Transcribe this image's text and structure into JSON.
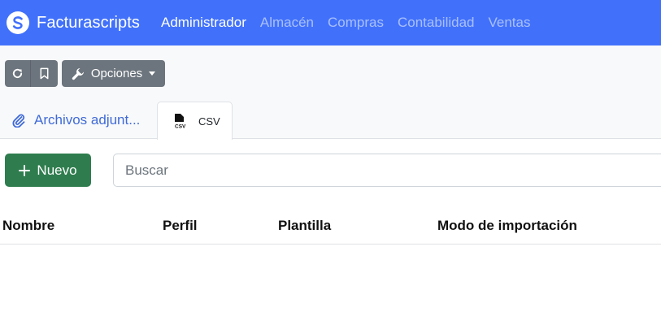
{
  "navbar": {
    "brand": "Facturascripts",
    "items": [
      {
        "label": "Administrador",
        "active": true
      },
      {
        "label": "Almacén",
        "active": false
      },
      {
        "label": "Compras",
        "active": false
      },
      {
        "label": "Contabilidad",
        "active": false
      },
      {
        "label": "Ventas",
        "active": false
      }
    ]
  },
  "toolbar": {
    "refresh_icon": "refresh-icon",
    "bookmark_icon": "bookmark-icon",
    "options_label": "Opciones",
    "options_icon": "wrench-icon"
  },
  "tabs": [
    {
      "label": "Archivos adjunt...",
      "icon": "paperclip-icon",
      "active": false
    },
    {
      "label": "CSV",
      "icon": "csv-file-icon",
      "active": true
    }
  ],
  "actions": {
    "new_label": "Nuevo",
    "search_placeholder": "Buscar"
  },
  "table": {
    "columns": [
      "Nombre",
      "Perfil",
      "Plantilla",
      "Modo de importación"
    ]
  },
  "colors": {
    "navbar": "#4171fb",
    "new_button": "#2f7d4e",
    "secondary_button": "#6c757d",
    "tab_link": "#3f6ad8"
  }
}
